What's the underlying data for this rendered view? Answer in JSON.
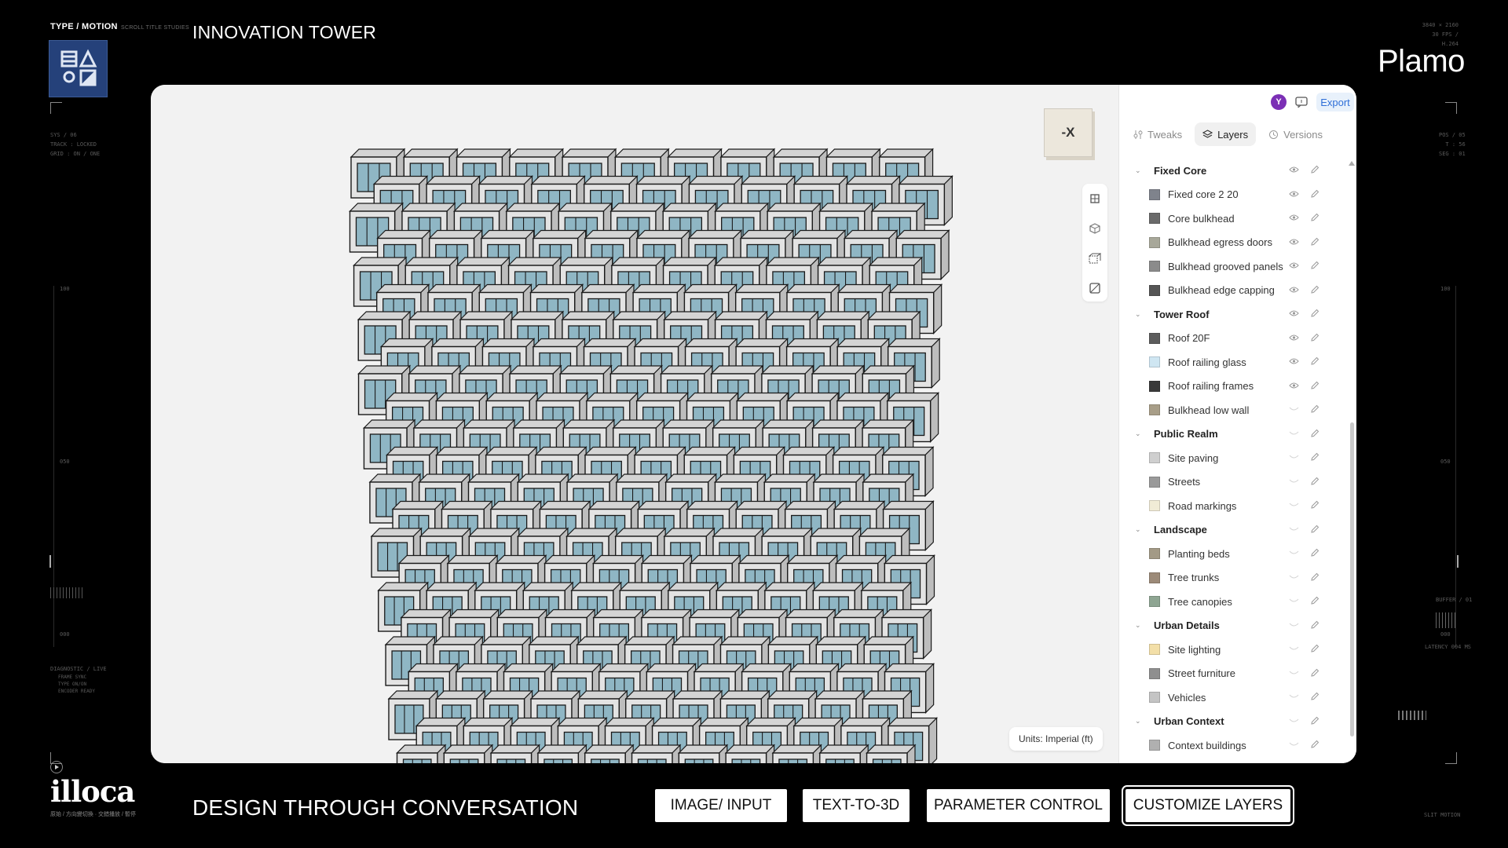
{
  "hud": {
    "type_motion": "TYPE / MOTION",
    "studio": "SCROLL TITLE STUDIES",
    "title": "INNOVATION TOWER",
    "brand": "Plamo",
    "specs": [
      "3840 × 2160",
      "30 FPS / H.264"
    ],
    "left_status": [
      "SYS / 06",
      "TRACK : LOCKED",
      "GRID : ON / ONE"
    ],
    "right_status": [
      "POS / 05",
      "T : 56",
      "SEG : 01"
    ],
    "left_scale": [
      "100",
      "050",
      "000"
    ],
    "right_scale": [
      "100",
      "050",
      "000"
    ],
    "diagnostics_title": "DIAGNOSTIC / LIVE",
    "diagnostics": [
      "FRAME SYNC",
      "TYPE ON/ON",
      "ENCODER READY"
    ],
    "buffer": "BUFFER / 01",
    "latency": "LATENCY 004 MS",
    "slit_motion": "SLIT MOTION",
    "illoca": "illoca",
    "illoca_sub": "原始 / 方向變切換 · 交錯播放 / 暫停",
    "tagline": "DESIGN THROUGH CONVERSATION"
  },
  "steps": [
    {
      "label": "IMAGE/ INPUT",
      "selected": false
    },
    {
      "label": "TEXT-TO-3D",
      "selected": false
    },
    {
      "label": "PARAMETER CONTROL",
      "selected": false
    },
    {
      "label": "CUSTOMIZE LAYERS",
      "selected": true
    }
  ],
  "app": {
    "viewport": {
      "navcube_label": "-X",
      "units": "Units: Imperial (ft)"
    },
    "header": {
      "avatar": "Y",
      "export": "Export"
    },
    "tabs": [
      {
        "label": "Tweaks",
        "icon": "sliders-icon",
        "active": false
      },
      {
        "label": "Layers",
        "icon": "layers-icon",
        "active": true
      },
      {
        "label": "Versions",
        "icon": "history-icon",
        "active": false
      }
    ],
    "layers": [
      {
        "type": "group",
        "name": "Fixed Core",
        "visible": true
      },
      {
        "type": "item",
        "name": "Fixed core 2 20",
        "color": "#7f838c",
        "visible": true
      },
      {
        "type": "item",
        "name": "Core bulkhead",
        "color": "#6a6a6a",
        "visible": true
      },
      {
        "type": "item",
        "name": "Bulkhead egress doors",
        "color": "#a8a89a",
        "visible": true
      },
      {
        "type": "item",
        "name": "Bulkhead grooved panels",
        "color": "#8b8b8b",
        "visible": true
      },
      {
        "type": "item",
        "name": "Bulkhead edge capping",
        "color": "#555555",
        "visible": true
      },
      {
        "type": "group",
        "name": "Tower Roof",
        "visible": true
      },
      {
        "type": "item",
        "name": "Roof 20F",
        "color": "#5c5c5c",
        "visible": true
      },
      {
        "type": "item",
        "name": "Roof railing glass",
        "color": "#cfe6f2",
        "visible": true
      },
      {
        "type": "item",
        "name": "Roof railing frames",
        "color": "#3a3a3a",
        "visible": true
      },
      {
        "type": "item",
        "name": "Bulkhead low wall",
        "color": "#a89e88",
        "visible": false
      },
      {
        "type": "group",
        "name": "Public Realm",
        "visible": false
      },
      {
        "type": "item",
        "name": "Site paving",
        "color": "#cfcfcf",
        "visible": false
      },
      {
        "type": "item",
        "name": "Streets",
        "color": "#9a9a9a",
        "visible": false
      },
      {
        "type": "item",
        "name": "Road markings",
        "color": "#f1ecd6",
        "visible": false
      },
      {
        "type": "group",
        "name": "Landscape",
        "visible": false
      },
      {
        "type": "item",
        "name": "Planting beds",
        "color": "#a39a86",
        "visible": false
      },
      {
        "type": "item",
        "name": "Tree trunks",
        "color": "#9c8a78",
        "visible": false
      },
      {
        "type": "item",
        "name": "Tree canopies",
        "color": "#8ea592",
        "visible": false
      },
      {
        "type": "group",
        "name": "Urban Details",
        "visible": false
      },
      {
        "type": "item",
        "name": "Site lighting",
        "color": "#f3dfa8",
        "visible": false
      },
      {
        "type": "item",
        "name": "Street furniture",
        "color": "#8f8f8f",
        "visible": false
      },
      {
        "type": "item",
        "name": "Vehicles",
        "color": "#c4c4c4",
        "visible": false
      },
      {
        "type": "group",
        "name": "Urban Context",
        "visible": false
      },
      {
        "type": "item",
        "name": "Context buildings",
        "color": "#b0b0b0",
        "visible": false
      }
    ]
  },
  "colors": {
    "glass": "#8fb6c4",
    "frame": "#e3e3e3",
    "accent": "#2f6fd8",
    "logo": "#25417a"
  }
}
